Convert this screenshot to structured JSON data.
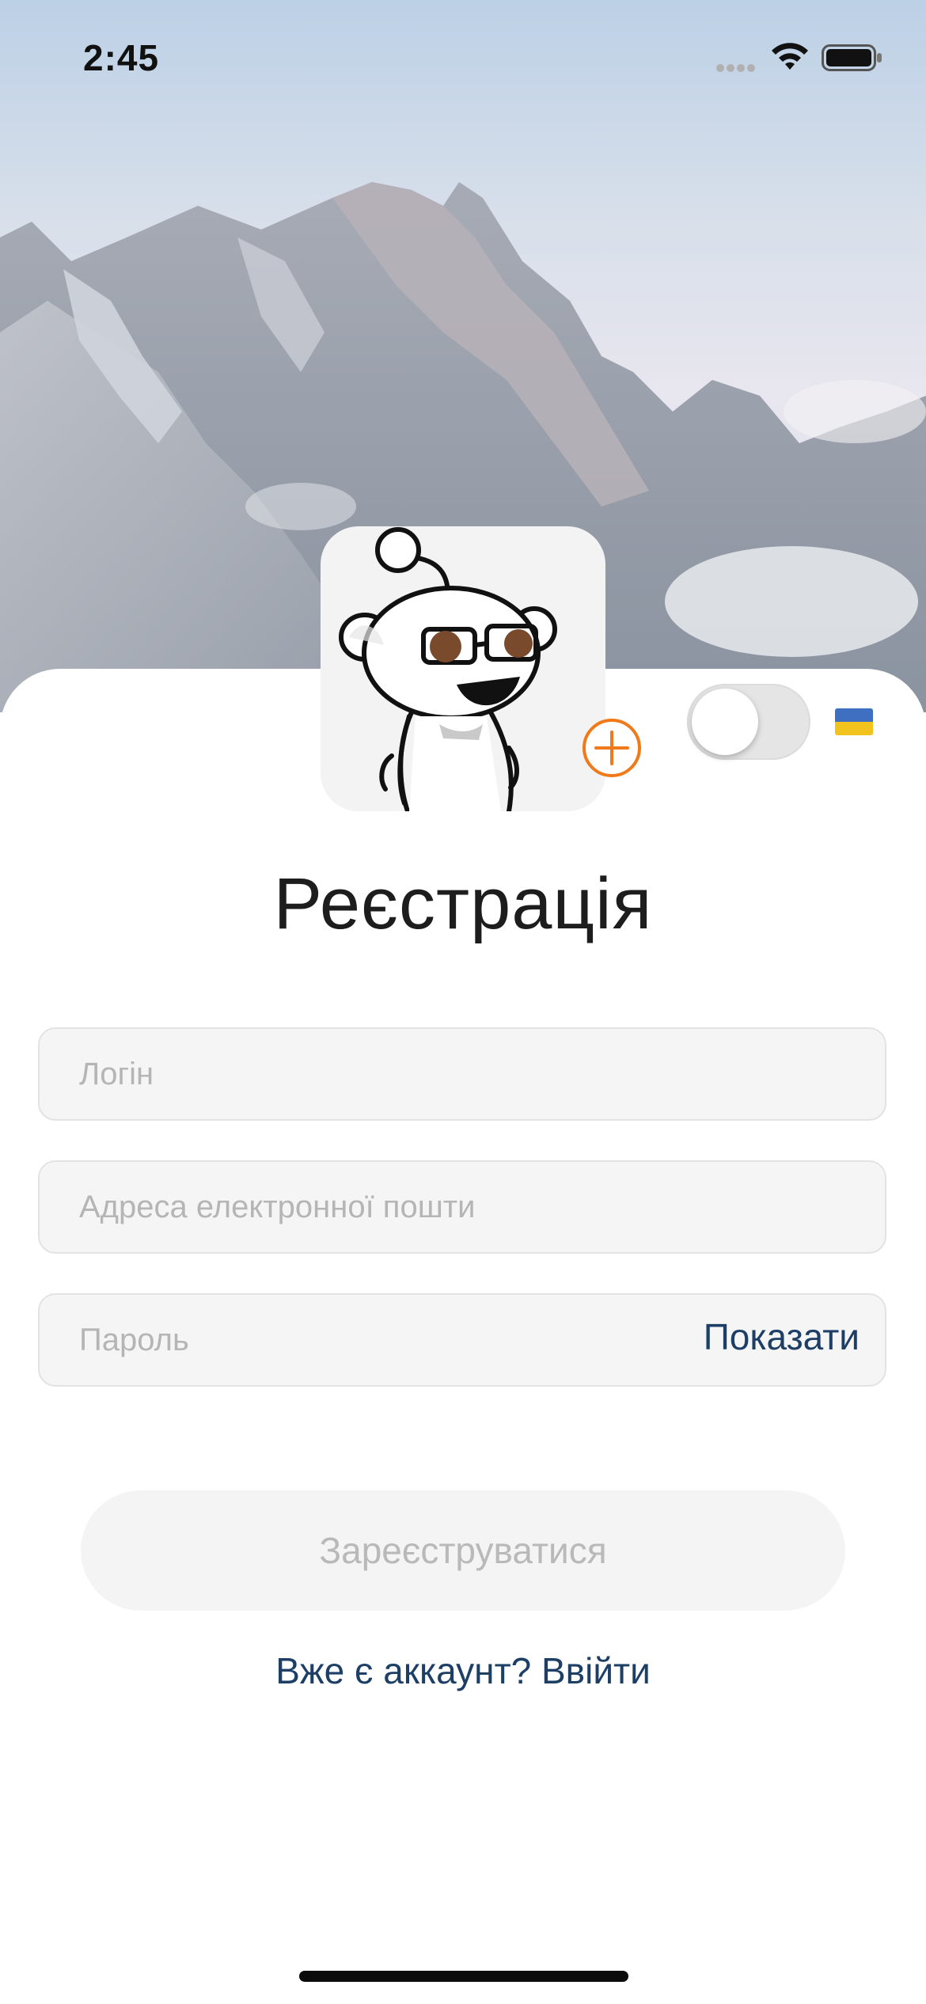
{
  "status_bar": {
    "time": "2:45"
  },
  "header": {
    "background_image": "mountain-landscape"
  },
  "profile": {
    "avatar_icon": "reddit-snoo-avatar",
    "add_icon": "plus-circle-icon",
    "accent_color": "#f07a1a"
  },
  "theme_toggle": {
    "state": "off"
  },
  "language": {
    "flag": "ukraine-flag",
    "colors": [
      "#3f6fc0",
      "#f3c31d"
    ]
  },
  "form": {
    "title": "Реєстрація",
    "login_placeholder": "Логін",
    "email_placeholder": "Адреса електронної пошти",
    "password_placeholder": "Пароль",
    "show_password_label": "Показати",
    "submit_label": "Зареєструватися",
    "login_link": "Вже є аккаунт? Ввійти"
  },
  "colors": {
    "link": "#1d3f66",
    "field_bg": "#f5f5f5",
    "disabled_text": "#b9b9b9"
  }
}
